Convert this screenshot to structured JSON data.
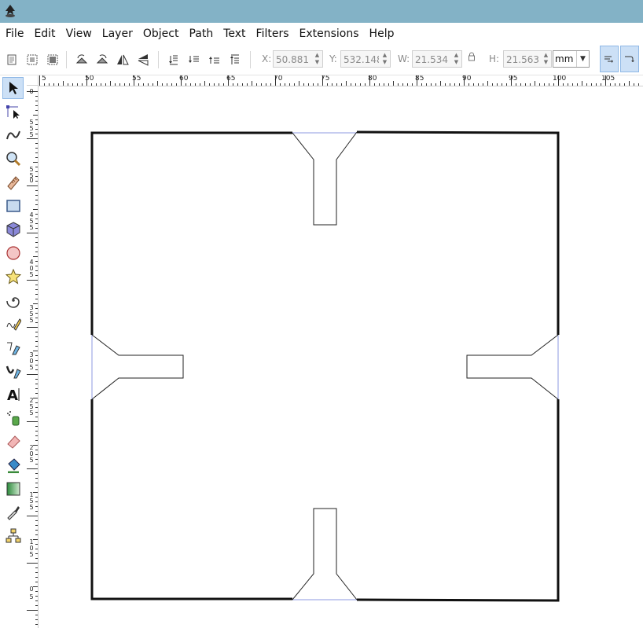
{
  "app": {
    "logo_icon": "inkscape-logo-icon"
  },
  "menu": [
    "File",
    "Edit",
    "View",
    "Layer",
    "Object",
    "Path",
    "Text",
    "Filters",
    "Extensions",
    "Help"
  ],
  "controls": {
    "x_label": "X:",
    "x_value": "50.881",
    "y_label": "Y:",
    "y_value": "532.148",
    "w_label": "W:",
    "w_value": "21.534",
    "h_label": "H:",
    "h_value": "21.563",
    "unit": "mm",
    "lock_icon": "lock-icon"
  },
  "ruler": {
    "h_labels": [
      "5",
      "50",
      "55",
      "60",
      "65",
      "70",
      "75",
      "80",
      "85",
      "90",
      "95",
      "100",
      "105"
    ],
    "v_labels": [
      "0",
      "5",
      "5",
      "5",
      "0",
      "5",
      "5",
      "4",
      "5",
      "5",
      "4",
      "0",
      "5",
      "3",
      "5",
      "5",
      "3",
      "0",
      "5",
      "2",
      "5",
      "5",
      "2",
      "0",
      "5",
      "1",
      "5",
      "5",
      "1",
      "0",
      "5",
      "0",
      "5"
    ]
  },
  "tools": [
    "selector-tool-icon",
    "node-tool-icon",
    "tweak-tool-icon",
    "zoom-tool-icon",
    "measure-tool-icon",
    "rectangle-tool-icon",
    "3d-box-tool-icon",
    "ellipse-tool-icon",
    "star-tool-icon",
    "spiral-tool-icon",
    "pencil-tool-icon",
    "pen-tool-icon",
    "calligraphy-tool-icon",
    "text-tool-icon",
    "spray-tool-icon",
    "eraser-tool-icon",
    "paint-bucket-tool-icon",
    "gradient-tool-icon",
    "dropper-tool-icon",
    "connector-tool-icon"
  ],
  "colors": {
    "titlebar": "#83b2c6",
    "selection_guide": "#8c9ae0",
    "active_tool": "#cce0f6"
  }
}
